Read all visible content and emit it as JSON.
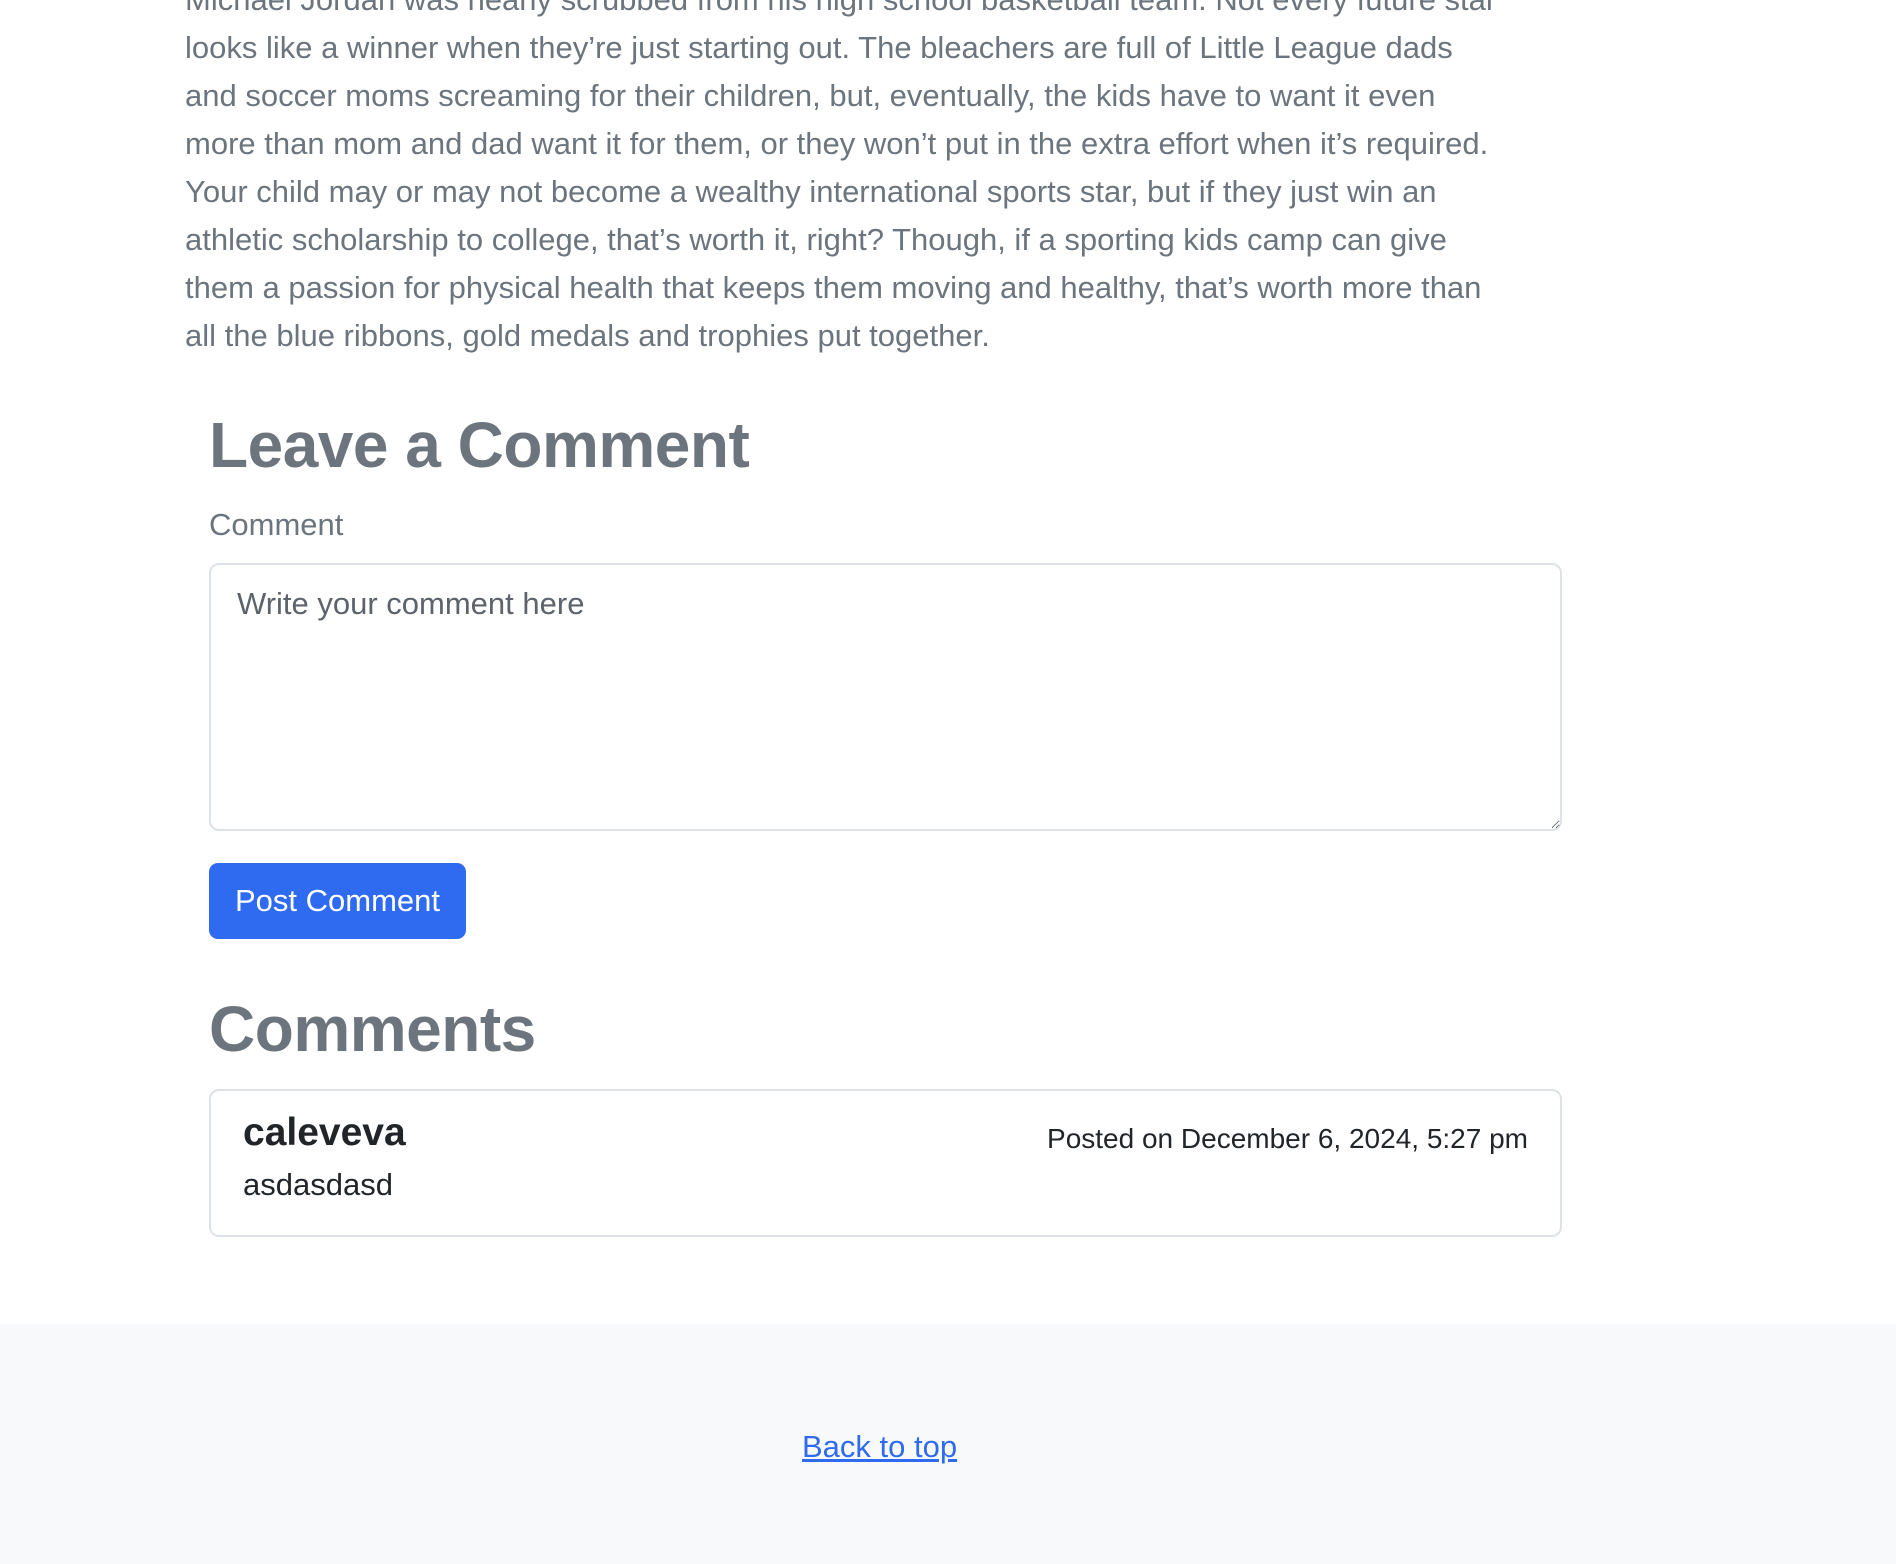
{
  "article": {
    "lines": [
      "Michael Jordan was nearly scrubbed from his high school basketball team. Not every future star",
      "looks like a winner when they’re just starting out. The bleachers are full of Little League dads",
      "and soccer moms screaming for their children, but, eventually, the kids have to want it even",
      "more than mom and dad want it for them, or they won’t put in the extra effort when it’s required.",
      "Your child may or may not become a wealthy international sports star, but if they just win an",
      "athletic scholarship to college, that’s worth it, right? Though, if a sporting kids camp can give",
      "them a passion for physical health that keeps them moving and healthy, that’s worth more than",
      "all the blue ribbons, gold medals and trophies put together."
    ]
  },
  "comment_form": {
    "heading": "Leave a Comment",
    "label": "Comment",
    "placeholder": "Write your comment here",
    "value": "",
    "submit_label": "Post Comment"
  },
  "comments": {
    "heading": "Comments",
    "items": [
      {
        "author": "caleveva",
        "date": "Posted on December 6, 2024, 5:27 pm",
        "body": "asdasdasd"
      }
    ]
  },
  "footer": {
    "back_to_top": "Back to top"
  },
  "colors": {
    "muted_text": "#6c757d",
    "primary": "#2f6bf0",
    "border": "#dee2e6",
    "footer_bg": "#f8f9fa"
  }
}
